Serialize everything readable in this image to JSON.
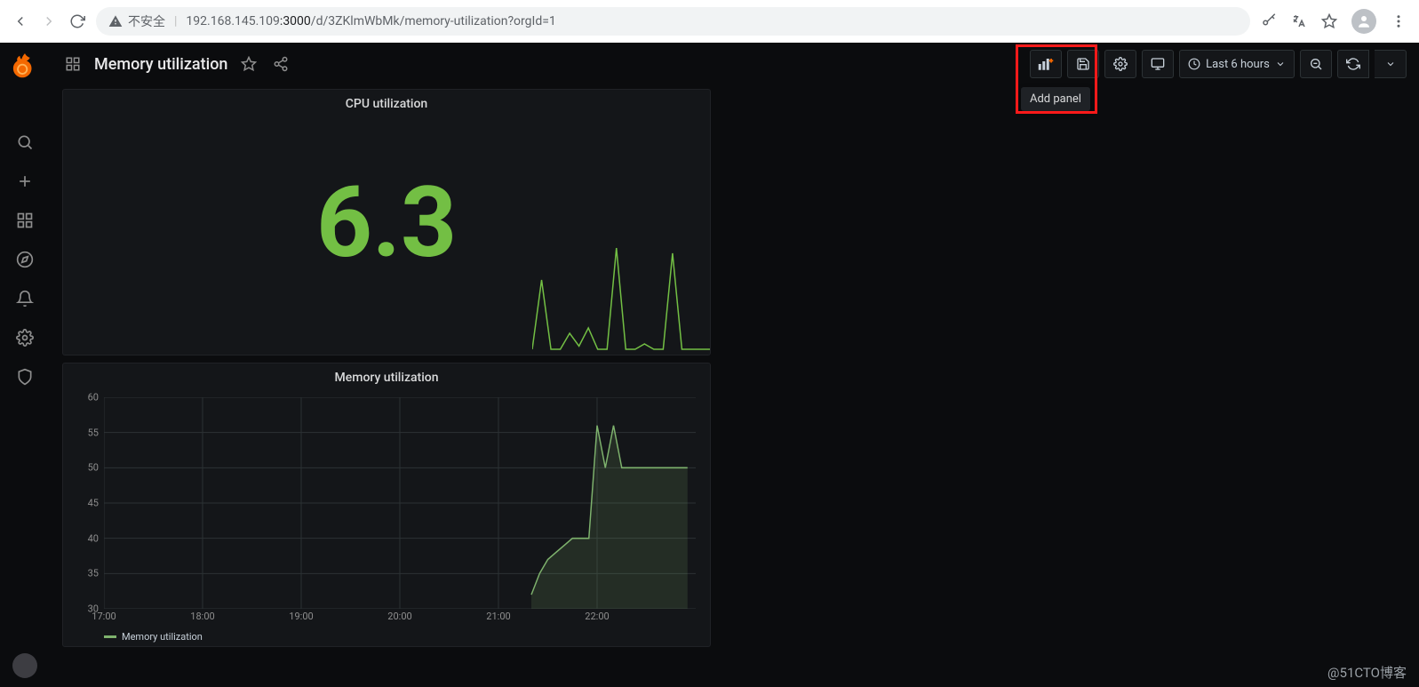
{
  "browser": {
    "insecure_label": "不安全",
    "url_host": "192.168.145.109",
    "url_port": ":3000",
    "url_path": "/d/3ZKlmWbMk/memory-utilization?orgId=1"
  },
  "dashboard": {
    "title": "Memory utilization"
  },
  "toolbar": {
    "add_panel_tooltip": "Add panel",
    "time_range_label": "Last 6 hours"
  },
  "panel_cpu": {
    "title": "CPU utilization",
    "value": "6.3"
  },
  "panel_mem": {
    "title": "Memory utilization",
    "legend": "Memory utilization"
  },
  "chart_data": [
    {
      "type": "line",
      "title": "Memory utilization",
      "xlabel": "",
      "ylabel": "",
      "ylim": [
        30,
        60
      ],
      "x_ticks": [
        "17:00",
        "18:00",
        "19:00",
        "20:00",
        "21:00",
        "22:00"
      ],
      "y_ticks": [
        30,
        35,
        40,
        45,
        50,
        55,
        60
      ],
      "x": [
        "21:20",
        "21:25",
        "21:30",
        "21:35",
        "21:40",
        "21:45",
        "21:50",
        "21:55",
        "22:00",
        "22:05",
        "22:10",
        "22:15",
        "22:20",
        "22:25",
        "22:30",
        "22:35",
        "22:40",
        "22:45",
        "22:50",
        "22:55"
      ],
      "series": [
        {
          "name": "Memory utilization",
          "values": [
            32,
            35,
            37,
            38,
            39,
            40,
            40,
            40,
            56,
            50,
            56,
            50,
            50,
            50,
            50,
            50,
            50,
            50,
            50,
            50
          ]
        }
      ],
      "legend": [
        "Memory utilization"
      ],
      "color": "#7eb26d"
    },
    {
      "type": "line",
      "title": "CPU utilization sparkline",
      "x": [
        0,
        1,
        2,
        3,
        4,
        5,
        6,
        7,
        8,
        9,
        10,
        11,
        12,
        13,
        14,
        15,
        16,
        17,
        18,
        19
      ],
      "series": [
        {
          "name": "CPU",
          "values": [
            5,
            70,
            5,
            5,
            20,
            8,
            25,
            5,
            5,
            100,
            5,
            5,
            10,
            5,
            5,
            95,
            5,
            5,
            5,
            5
          ]
        }
      ],
      "color": "#73bf44"
    }
  ],
  "watermark": "@51CTO博客"
}
